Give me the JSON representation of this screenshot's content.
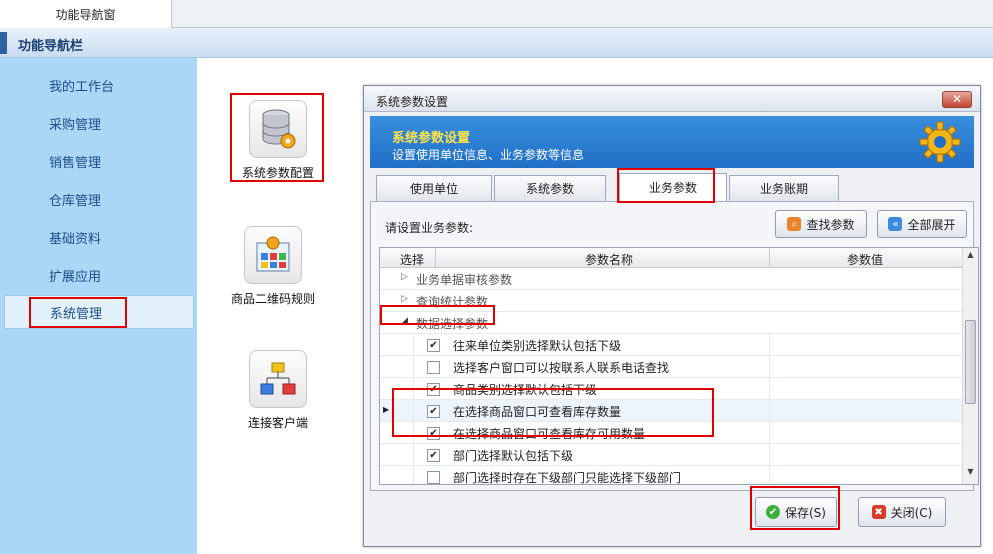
{
  "top_tab": {
    "label": "功能导航窗"
  },
  "nav_header": {
    "title": "功能导航栏"
  },
  "sidebar": {
    "items": [
      {
        "label": "我的工作台"
      },
      {
        "label": "采购管理"
      },
      {
        "label": "销售管理"
      },
      {
        "label": "仓库管理"
      },
      {
        "label": "基础资料"
      },
      {
        "label": "扩展应用"
      },
      {
        "label": "系统管理",
        "active": true
      }
    ]
  },
  "tiles": [
    {
      "label": "系统参数配置",
      "icon": "database-gear-icon"
    },
    {
      "label": "商品二维码规则",
      "icon": "qr-rule-icon"
    },
    {
      "label": "连接客户端",
      "icon": "network-icon"
    }
  ],
  "dialog": {
    "title": "系统参数设置",
    "close_label": "✕",
    "banner_title": "系统参数设置",
    "banner_subtitle": "设置使用单位信息、业务参数等信息",
    "tabs": [
      {
        "label": "使用单位"
      },
      {
        "label": "系统参数"
      },
      {
        "label": "业务参数",
        "selected": true
      },
      {
        "label": "业务账期"
      }
    ],
    "prompt": "请设置业务参数:",
    "find_button": "查找参数",
    "expand_button": "全部展开",
    "grid": {
      "columns": [
        "选择",
        "参数名称",
        "参数值"
      ],
      "groups": [
        {
          "label": "业务单据审核参数",
          "expanded": false
        },
        {
          "label": "查询统计参数",
          "expanded": false
        },
        {
          "label": "数据选择参数",
          "expanded": true
        }
      ],
      "rows": [
        {
          "checked": true,
          "name": "往来单位类别选择默认包括下级"
        },
        {
          "checked": false,
          "name": "选择客户窗口可以按联系人联系电话查找"
        },
        {
          "checked": true,
          "name": "商品类别选择默认包括下级"
        },
        {
          "checked": true,
          "name": "在选择商品窗口可查看库存数量",
          "current": true
        },
        {
          "checked": true,
          "name": "在选择商品窗口可查看库存可用数量"
        },
        {
          "checked": true,
          "name": "部门选择默认包括下级"
        },
        {
          "checked": false,
          "name": "部门选择时存在下级部门只能选择下级部门"
        }
      ]
    },
    "save_button": "保存(S)",
    "close_button": "关闭(C)"
  },
  "colors": {
    "sidebar_bg": "#abd6f5",
    "banner_bg": "#1f6fc6",
    "banner_title": "#ffe24a",
    "highlight_box": "#e10000"
  }
}
